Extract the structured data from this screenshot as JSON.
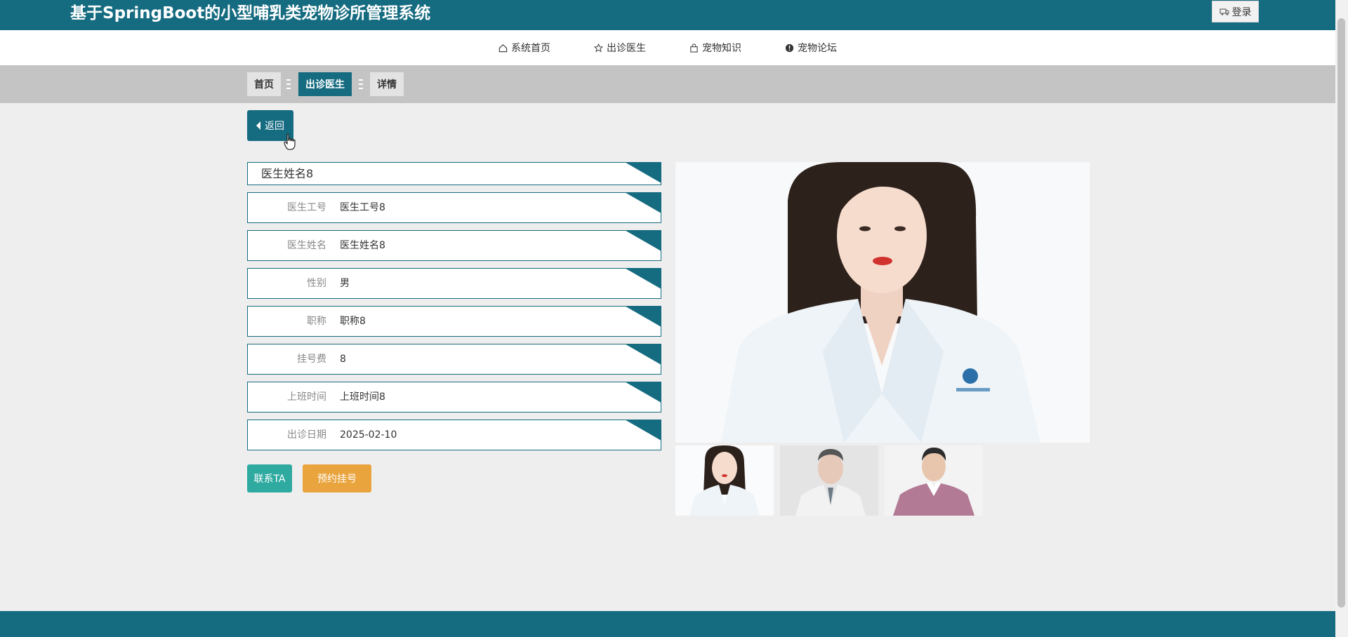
{
  "header": {
    "title": "基于SpringBoot的小型哺乳类宠物诊所管理系统",
    "login_label": "登录"
  },
  "nav": {
    "items": [
      {
        "label": "系统首页",
        "icon": "home-icon"
      },
      {
        "label": "出诊医生",
        "icon": "star-icon"
      },
      {
        "label": "宠物知识",
        "icon": "bag-icon"
      },
      {
        "label": "宠物论坛",
        "icon": "alert-circle-icon"
      }
    ]
  },
  "breadcrumb": {
    "items": [
      "首页",
      "出诊医生",
      "详情"
    ],
    "active_index": 1
  },
  "back_label": "返回",
  "detail": {
    "title": "医生姓名8",
    "fields": [
      {
        "label": "医生工号",
        "value": "医生工号8"
      },
      {
        "label": "医生姓名",
        "value": "医生姓名8"
      },
      {
        "label": "性别",
        "value": "男"
      },
      {
        "label": "职称",
        "value": "职称8"
      },
      {
        "label": "挂号费",
        "value": "8"
      },
      {
        "label": "上班时间",
        "value": "上班时间8"
      },
      {
        "label": "出诊日期",
        "value": "2025-02-10"
      }
    ]
  },
  "actions": {
    "contact_label": "联系TA",
    "book_label": "预约挂号"
  },
  "colors": {
    "primary": "#156b80",
    "contact": "#2eaaa0",
    "book": "#e9a43d",
    "crumb_bg": "#c4c4c4",
    "page_bg": "#efeeee"
  }
}
